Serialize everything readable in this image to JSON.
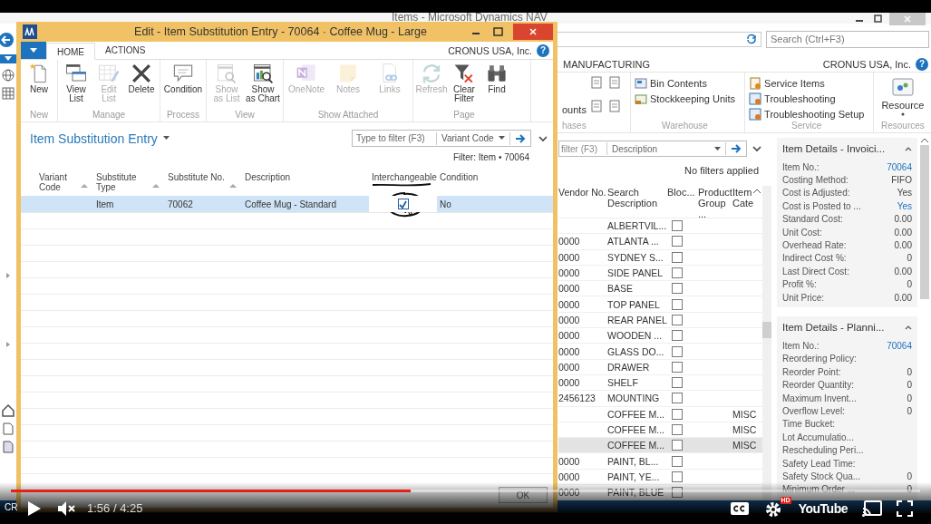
{
  "background_window": {
    "title": "Items - Microsoft Dynamics NAV",
    "search": {
      "placeholder": "Search (Ctrl+F3)"
    },
    "ribbon_tab": "MANUFACTURING",
    "company": "CRONUS USA, Inc.",
    "help_icon": "?",
    "ribbon_groups": [
      {
        "label": "hases",
        "kind": "cut",
        "items": [
          {
            "label": "ounts"
          }
        ]
      },
      {
        "label": "Warehouse",
        "kind": "small",
        "items": [
          {
            "label": "Bin Contents"
          },
          {
            "label": "Stockkeeping Units"
          }
        ]
      },
      {
        "label": "Service",
        "kind": "small",
        "items": [
          {
            "label": "Service Items"
          },
          {
            "label": "Troubleshooting"
          },
          {
            "label": "Troubleshooting Setup"
          }
        ]
      },
      {
        "label": "Resources",
        "kind": "large",
        "items": [
          {
            "label": "Resource"
          }
        ]
      }
    ],
    "filter": {
      "placeholder": "filter (F3)",
      "field": "Description"
    },
    "filter_status": "No filters applied",
    "columns": [
      "Vendor No.",
      "Search Description",
      "Bloc...",
      "Product Group ...",
      "Item Cate"
    ],
    "rows": [
      {
        "vendor_no": "",
        "search_description": "ALBERTVIL...",
        "blocked": false,
        "item_category": "",
        "selected": false
      },
      {
        "vendor_no": "0000",
        "search_description": "ATLANTA ...",
        "blocked": false,
        "item_category": "",
        "selected": false
      },
      {
        "vendor_no": "0000",
        "search_description": "SYDNEY S...",
        "blocked": false,
        "item_category": "",
        "selected": false
      },
      {
        "vendor_no": "0000",
        "search_description": "SIDE PANEL",
        "blocked": false,
        "item_category": "",
        "selected": false
      },
      {
        "vendor_no": "0000",
        "search_description": "BASE",
        "blocked": false,
        "item_category": "",
        "selected": false
      },
      {
        "vendor_no": "0000",
        "search_description": "TOP PANEL",
        "blocked": false,
        "item_category": "",
        "selected": false
      },
      {
        "vendor_no": "0000",
        "search_description": "REAR PANEL",
        "blocked": false,
        "item_category": "",
        "selected": false
      },
      {
        "vendor_no": "0000",
        "search_description": "WOODEN ...",
        "blocked": false,
        "item_category": "",
        "selected": false
      },
      {
        "vendor_no": "0000",
        "search_description": "GLASS DO...",
        "blocked": false,
        "item_category": "",
        "selected": false
      },
      {
        "vendor_no": "0000",
        "search_description": "DRAWER",
        "blocked": false,
        "item_category": "",
        "selected": false
      },
      {
        "vendor_no": "0000",
        "search_description": "SHELF",
        "blocked": false,
        "item_category": "",
        "selected": false
      },
      {
        "vendor_no": "2456123",
        "search_description": "MOUNTING",
        "blocked": false,
        "item_category": "",
        "selected": false
      },
      {
        "vendor_no": "",
        "search_description": "COFFEE M...",
        "blocked": false,
        "item_category": "MISC",
        "selected": false
      },
      {
        "vendor_no": "",
        "search_description": "COFFEE M...",
        "blocked": false,
        "item_category": "MISC",
        "selected": false
      },
      {
        "vendor_no": "",
        "search_description": "COFFEE M...",
        "blocked": false,
        "item_category": "MISC",
        "selected": true
      },
      {
        "vendor_no": "0000",
        "search_description": "PAINT, BL...",
        "blocked": false,
        "item_category": "",
        "selected": false
      },
      {
        "vendor_no": "0000",
        "search_description": "PAINT, YE...",
        "blocked": false,
        "item_category": "",
        "selected": false
      },
      {
        "vendor_no": "0000",
        "search_description": "PAINT, BLUE",
        "blocked": false,
        "item_category": "",
        "selected": false
      }
    ],
    "factboxes": [
      {
        "title": "Item Details - Invoici...",
        "fields": [
          {
            "label": "Item No.:",
            "value": "70064",
            "link": true
          },
          {
            "label": "Costing Method:",
            "value": "FIFO",
            "link": false
          },
          {
            "label": "Cost is Adjusted:",
            "value": "Yes",
            "link": false
          },
          {
            "label": "Cost is Posted to ...",
            "value": "Yes",
            "link": true
          },
          {
            "label": "Standard Cost:",
            "value": "0.00",
            "link": false
          },
          {
            "label": "Unit Cost:",
            "value": "0.00",
            "link": false
          },
          {
            "label": "Overhead Rate:",
            "value": "0.00",
            "link": false
          },
          {
            "label": "Indirect Cost %:",
            "value": "0",
            "link": false
          },
          {
            "label": "Last Direct Cost:",
            "value": "0.00",
            "link": false
          },
          {
            "label": "Profit %:",
            "value": "0",
            "link": false
          },
          {
            "label": "Unit Price:",
            "value": "0.00",
            "link": false
          }
        ]
      },
      {
        "title": "Item Details - Planni...",
        "fields": [
          {
            "label": "Item No.:",
            "value": "70064",
            "link": true
          },
          {
            "label": "Reordering Policy:"
          },
          {
            "label": "Reorder Point:",
            "value": "0",
            "link": false
          },
          {
            "label": "Reorder Quantity:",
            "value": "0",
            "link": false
          },
          {
            "label": "Maximum Invent...",
            "value": "0",
            "link": false
          },
          {
            "label": "Overflow Level:",
            "value": "0",
            "link": false
          },
          {
            "label": "Time Bucket:"
          },
          {
            "label": "Lot Accumulatio..."
          },
          {
            "label": "Rescheduling Peri..."
          },
          {
            "label": "Safety Lead Time:"
          },
          {
            "label": "Safety Stock Qua...",
            "value": "0",
            "link": false
          },
          {
            "label": "Minimum Order ...",
            "value": "0",
            "link": false
          }
        ]
      }
    ],
    "status_bar": "CR"
  },
  "dialog": {
    "title": "Edit - Item Substitution Entry - 70064 · Coffee Mug - Large",
    "tabs": [
      {
        "label": "HOME",
        "selected": true
      },
      {
        "label": "ACTIONS",
        "selected": false
      }
    ],
    "company": "CRONUS USA, Inc.",
    "help_icon": "?",
    "ribbon_groups": [
      {
        "label": "New",
        "items": [
          {
            "label": "New",
            "disabled": false
          }
        ]
      },
      {
        "label": "Manage",
        "items": [
          {
            "label": "View List",
            "disabled": false
          },
          {
            "label": "Edit List",
            "disabled": true
          },
          {
            "label": "Delete",
            "disabled": false
          }
        ]
      },
      {
        "label": "Process",
        "items": [
          {
            "label": "Condition",
            "disabled": false
          }
        ]
      },
      {
        "label": "View",
        "items": [
          {
            "label": "Show as List",
            "disabled": true
          },
          {
            "label": "Show as Chart",
            "disabled": false
          }
        ]
      },
      {
        "label": "Show Attached",
        "items": [
          {
            "label": "OneNote",
            "disabled": true
          },
          {
            "label": "Notes",
            "disabled": true
          },
          {
            "label": "Links",
            "disabled": true
          }
        ]
      },
      {
        "label": "Page",
        "items": [
          {
            "label": "Refresh",
            "disabled": true
          },
          {
            "label": "Clear Filter",
            "disabled": false
          },
          {
            "label": "Find",
            "disabled": false
          }
        ]
      }
    ],
    "page_title": "Item Substitution Entry",
    "filter": {
      "placeholder": "Type to filter (F3)",
      "field": "Variant Code"
    },
    "filter_status": "Filter: Item • 70064",
    "columns": [
      "Variant Code",
      "Substitute Type",
      "Substitute No.",
      "Description",
      "Interchangeable",
      "Condition"
    ],
    "rows": [
      {
        "variant_code": "",
        "substitute_type": "Item",
        "substitute_no": "70062",
        "description": "Coffee Mug - Standard",
        "interchangeable": true,
        "condition": "No",
        "selected": true
      }
    ],
    "ok_button": "OK"
  },
  "player": {
    "progress": {
      "level": 0.44
    },
    "muted": true,
    "time": "1:56 / 4:25",
    "hd_badge": "HD",
    "logo": "YouTube"
  }
}
